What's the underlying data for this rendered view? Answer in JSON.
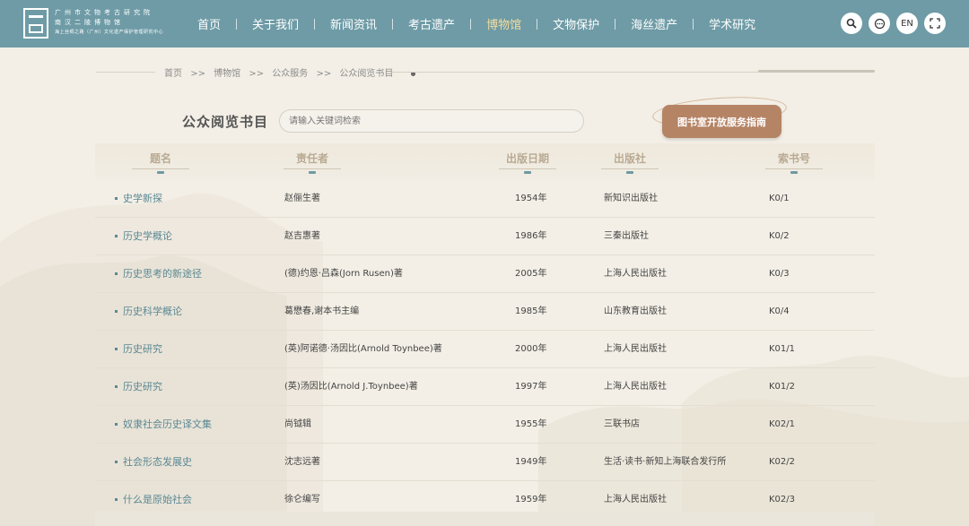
{
  "header": {
    "logo": {
      "line1": "广州市文物考古研究院",
      "line2": "南汉二陵博物馆",
      "line3": "海上丝绸之路（广州）文化遗产保护管理研究中心"
    },
    "nav": [
      {
        "label": "首页"
      },
      {
        "label": "关于我们"
      },
      {
        "label": "新闻资讯"
      },
      {
        "label": "考古遗产"
      },
      {
        "label": "博物馆",
        "active": true
      },
      {
        "label": "文物保护"
      },
      {
        "label": "海丝遗产"
      },
      {
        "label": "学术研究"
      }
    ],
    "icons": {
      "search": "search-icon",
      "chat": "chat-icon",
      "lang": "EN",
      "fullscreen": "fullscreen-icon"
    }
  },
  "breadcrumb": [
    "首页",
    ">>",
    "博物馆",
    ">>",
    "公众服务",
    ">>",
    "公众阅览书目"
  ],
  "page": {
    "title": "公众阅览书目",
    "search_placeholder": "请输入关键词检索",
    "guide_button": "图书室开放服务指南"
  },
  "table": {
    "headers": [
      "题名",
      "责任者",
      "出版日期",
      "出版社",
      "索书号"
    ],
    "rows": [
      {
        "title": "史学新探",
        "author": "赵俪生著",
        "date": "1954年",
        "publisher": "新知识出版社",
        "call": "K0/1"
      },
      {
        "title": "历史学概论",
        "author": "赵吉惠著",
        "date": "1986年",
        "publisher": "三秦出版社",
        "call": "K0/2"
      },
      {
        "title": "历史思考的新途径",
        "author": "(德)约恩·吕森(Jorn Rusen)著",
        "date": "2005年",
        "publisher": "上海人民出版社",
        "call": "K0/3"
      },
      {
        "title": "历史科学概论",
        "author": "葛懋春,谢本书主编",
        "date": "1985年",
        "publisher": "山东教育出版社",
        "call": "K0/4"
      },
      {
        "title": "历史研究",
        "author": "(英)阿诺德·汤因比(Arnold Toynbee)著",
        "date": "2000年",
        "publisher": "上海人民出版社",
        "call": "K01/1"
      },
      {
        "title": "历史研究",
        "author": "(英)汤因比(Arnold J.Toynbee)著",
        "date": "1997年",
        "publisher": "上海人民出版社",
        "call": "K01/2"
      },
      {
        "title": "奴隶社会历史译文集",
        "author": "尚钺辑",
        "date": "1955年",
        "publisher": "三联书店",
        "call": "K02/1"
      },
      {
        "title": "社会形态发展史",
        "author": "沈志远著",
        "date": "1949年",
        "publisher": "生活·读书·新知上海联合发行所",
        "call": "K02/2"
      },
      {
        "title": "什么是原始社会",
        "author": "徐仑编写",
        "date": "1959年",
        "publisher": "上海人民出版社",
        "call": "K02/3"
      }
    ]
  },
  "colors": {
    "header_bg": "#6e9ba6",
    "active_nav": "#f4dca0",
    "button": "#b58465",
    "link": "#5a8893"
  }
}
